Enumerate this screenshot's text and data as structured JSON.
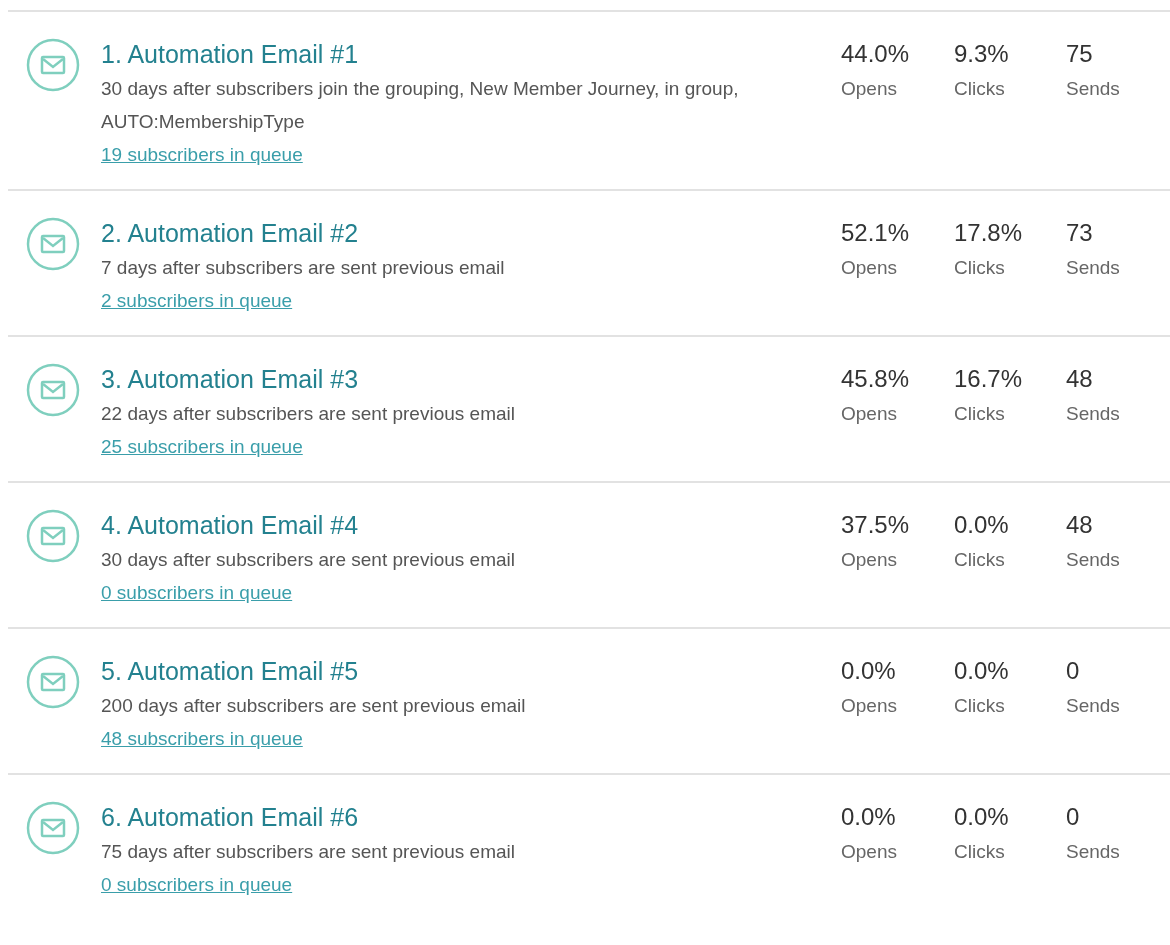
{
  "emails": [
    {
      "title": "1. Automation Email #1",
      "description": "30 days after subscribers join the grouping, New Member Journey, in group, AUTO:MembershipType",
      "queue": "19 subscribers in queue",
      "stats": [
        {
          "value": "44.0%",
          "label": "Opens"
        },
        {
          "value": "9.3%",
          "label": "Clicks"
        },
        {
          "value": "75",
          "label": "Sends"
        }
      ]
    },
    {
      "title": "2. Automation Email #2",
      "description": "7 days after subscribers are sent previous email",
      "queue": "2 subscribers in queue",
      "stats": [
        {
          "value": "52.1%",
          "label": "Opens"
        },
        {
          "value": "17.8%",
          "label": "Clicks"
        },
        {
          "value": "73",
          "label": "Sends"
        }
      ]
    },
    {
      "title": "3. Automation Email #3",
      "description": "22 days after subscribers are sent previous email",
      "queue": "25 subscribers in queue",
      "stats": [
        {
          "value": "45.8%",
          "label": "Opens"
        },
        {
          "value": "16.7%",
          "label": "Clicks"
        },
        {
          "value": "48",
          "label": "Sends"
        }
      ]
    },
    {
      "title": "4. Automation Email #4",
      "description": "30 days after subscribers are sent previous email",
      "queue": "0 subscribers in queue",
      "stats": [
        {
          "value": "37.5%",
          "label": "Opens"
        },
        {
          "value": "0.0%",
          "label": "Clicks"
        },
        {
          "value": "48",
          "label": "Sends"
        }
      ]
    },
    {
      "title": "5. Automation Email #5",
      "description": "200 days after subscribers are sent previous email",
      "queue": "48 subscribers in queue",
      "stats": [
        {
          "value": "0.0%",
          "label": "Opens"
        },
        {
          "value": "0.0%",
          "label": "Clicks"
        },
        {
          "value": "0",
          "label": "Sends"
        }
      ]
    },
    {
      "title": "6. Automation Email #6",
      "description": "75 days after subscribers are sent previous email",
      "queue": "0 subscribers in queue",
      "stats": [
        {
          "value": "0.0%",
          "label": "Opens"
        },
        {
          "value": "0.0%",
          "label": "Clicks"
        },
        {
          "value": "0",
          "label": "Sends"
        }
      ]
    }
  ]
}
